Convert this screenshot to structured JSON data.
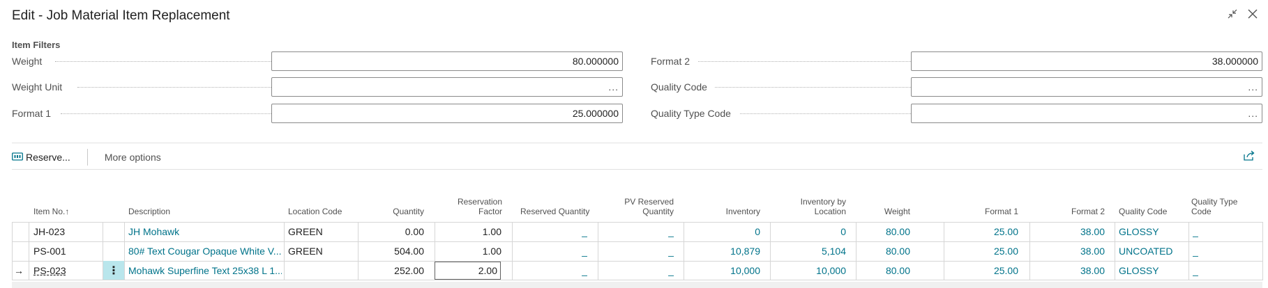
{
  "window": {
    "title": "Edit - Job Material Item Replacement",
    "collapse_icon": "collapse-icon",
    "close_icon": "close-icon"
  },
  "filters": {
    "section_title": "Item Filters",
    "weight": {
      "label": "Weight",
      "value": "80.000000"
    },
    "weight_unit": {
      "label": "Weight Unit",
      "value": "..."
    },
    "format1": {
      "label": "Format 1",
      "value": "25.000000"
    },
    "format2": {
      "label": "Format 2",
      "value": "38.000000"
    },
    "quality_code": {
      "label": "Quality Code",
      "value": "..."
    },
    "quality_type_code": {
      "label": "Quality Type Code",
      "value": "..."
    }
  },
  "toolbar": {
    "reserve_label": "Reserve...",
    "more_options_label": "More options"
  },
  "table": {
    "headers": {
      "item_no": "Item No.",
      "sort_indicator": "↑",
      "description": "Description",
      "location_code": "Location Code",
      "quantity": "Quantity",
      "reservation_factor_1": "Reservation",
      "reservation_factor_2": "Factor",
      "reserved_quantity": "Reserved Quantity",
      "pv_reserved_1": "PV Reserved",
      "pv_reserved_2": "Quantity",
      "inventory": "Inventory",
      "inventory_by_location_1": "Inventory by",
      "inventory_by_location_2": "Location",
      "weight": "Weight",
      "format1": "Format 1",
      "format2": "Format 2",
      "quality_code": "Quality Code",
      "quality_type_code_1": "Quality Type",
      "quality_type_code_2": "Code"
    },
    "rows": [
      {
        "indicator": "",
        "item_no": "JH-023",
        "description": "JH Mohawk",
        "location_code": "GREEN",
        "quantity": "0.00",
        "reservation_factor": "1.00",
        "reserved_quantity": "_",
        "pv_reserved_quantity": "_",
        "inventory": "0",
        "inventory_by_location": "0",
        "weight": "80.00",
        "format1": "25.00",
        "format2": "38.00",
        "quality_code": "GLOSSY",
        "quality_type_code": "_"
      },
      {
        "indicator": "",
        "item_no": "PS-001",
        "description": "80# Text Cougar Opaque White V...",
        "location_code": "GREEN",
        "quantity": "504.00",
        "reservation_factor": "1.00",
        "reserved_quantity": "_",
        "pv_reserved_quantity": "_",
        "inventory": "10,879",
        "inventory_by_location": "5,104",
        "weight": "80.00",
        "format1": "25.00",
        "format2": "38.00",
        "quality_code": "UNCOATED",
        "quality_type_code": "_"
      },
      {
        "indicator": "→",
        "item_no": "PS-023",
        "description": "Mohawk Superfine Text 25x38 L 1...",
        "location_code": "",
        "quantity": "252.00",
        "reservation_factor": "2.00",
        "reserved_quantity": "_",
        "pv_reserved_quantity": "_",
        "inventory": "10,000",
        "inventory_by_location": "10,000",
        "weight": "80.00",
        "format1": "25.00",
        "format2": "38.00",
        "quality_code": "GLOSSY",
        "quality_type_code": "_"
      }
    ],
    "row_menu_glyph": "⋮"
  },
  "colors": {
    "link": "#00738a",
    "selected_menu_cell": "#b9e6ec"
  }
}
